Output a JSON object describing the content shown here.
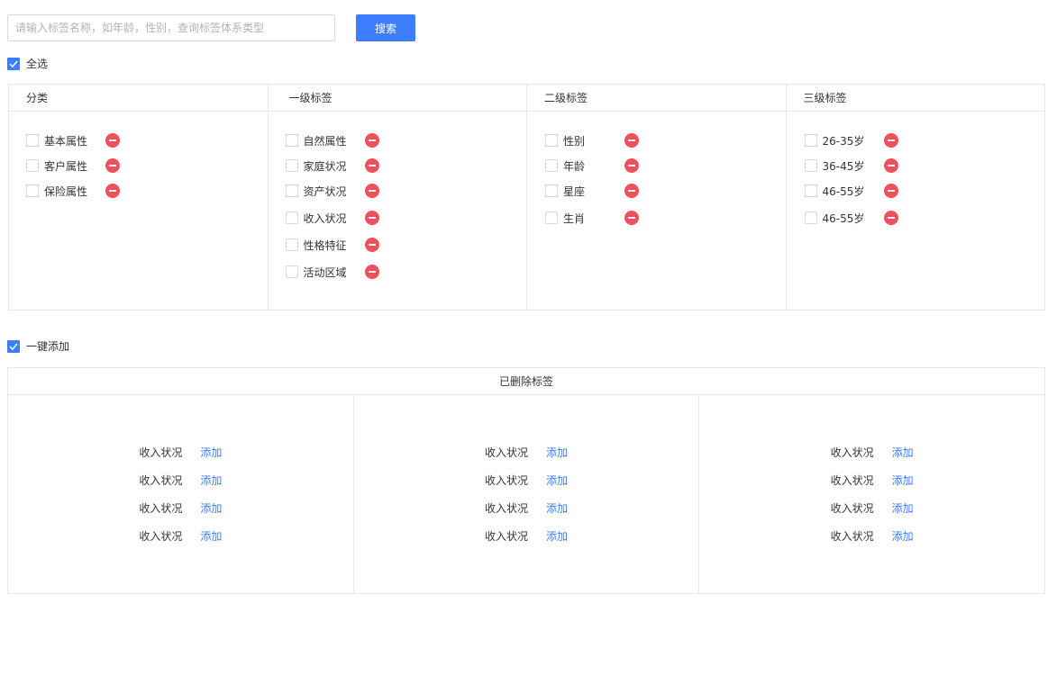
{
  "search": {
    "placeholder": "请输入标签名称，如年龄，性别，查询标签体系类型",
    "button_label": "搜索"
  },
  "select_all": {
    "label": "全选",
    "checked": true
  },
  "tag_table": {
    "columns": [
      {
        "header": "分类",
        "items": [
          "基本属性",
          "客户属性",
          "保险属性"
        ]
      },
      {
        "header": "一级标签",
        "items": [
          "自然属性",
          "家庭状况",
          "资产状况",
          "收入状况",
          "性格特征",
          "活动区域"
        ]
      },
      {
        "header": "二级标签",
        "items": [
          "性别",
          "年龄",
          "星座",
          "生肖"
        ]
      },
      {
        "header": "三级标签",
        "items": [
          "26-35岁",
          "36-45岁",
          "46-55岁",
          "46-55岁"
        ]
      }
    ]
  },
  "one_click_add": {
    "label": "一键添加",
    "checked": true
  },
  "deleted_table": {
    "title": "已删除标签",
    "add_label": "添加",
    "columns": [
      {
        "items": [
          "收入状况",
          "收入状况",
          "收入状况",
          "收入状况"
        ]
      },
      {
        "items": [
          "收入状况",
          "收入状况",
          "收入状况",
          "收入状况"
        ]
      },
      {
        "items": [
          "收入状况",
          "收入状况",
          "收入状况",
          "收入状况"
        ]
      }
    ]
  },
  "colors": {
    "accent": "#3d7eff",
    "remove": "#f0505c",
    "border": "#e8e8e8"
  },
  "icons": {
    "remove": "minus-circle-icon",
    "check": "checkmark-icon"
  }
}
